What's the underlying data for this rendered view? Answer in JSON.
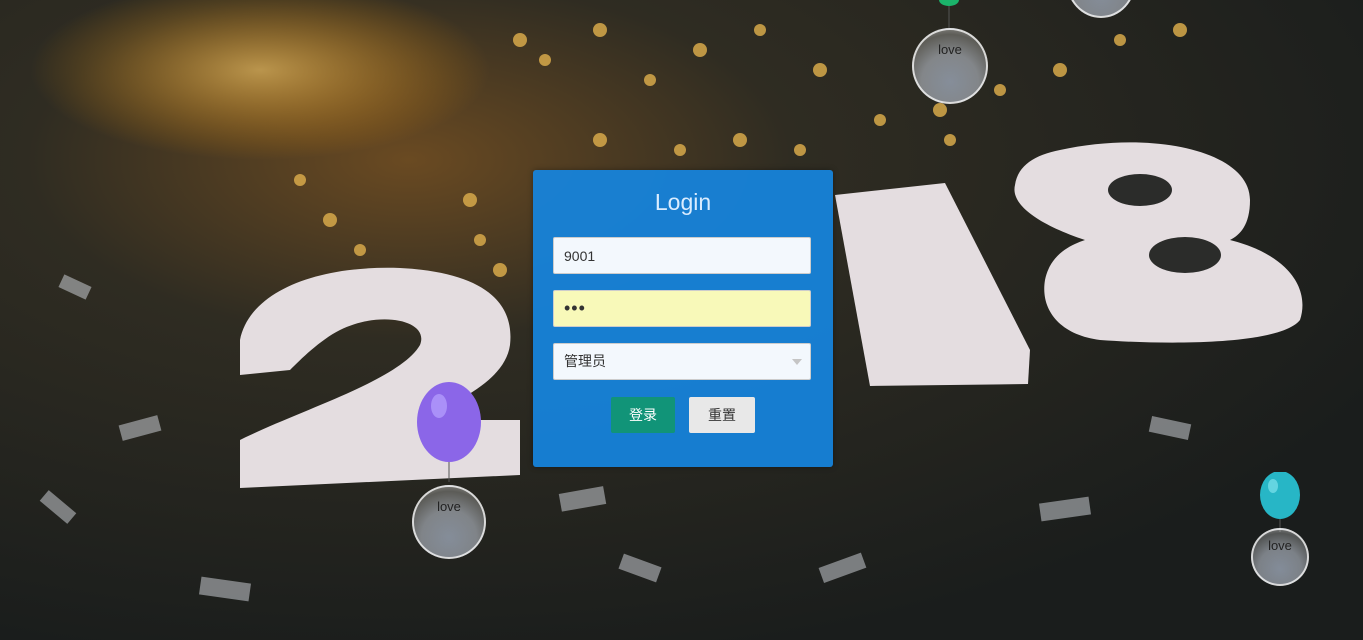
{
  "login": {
    "title": "Login",
    "username_value": "9001",
    "password_value": "•••",
    "role_selected": "管理员",
    "login_button": "登录",
    "reset_button": "重置"
  },
  "decorations": {
    "balloon_text": "love"
  },
  "colors": {
    "panel": "#1684de",
    "login_button": "#119478",
    "reset_button": "#e8e8e8",
    "password_autofill": "#f8f9b9",
    "balloon_purple": "#8b66e8",
    "balloon_teal": "#27b6c6"
  }
}
